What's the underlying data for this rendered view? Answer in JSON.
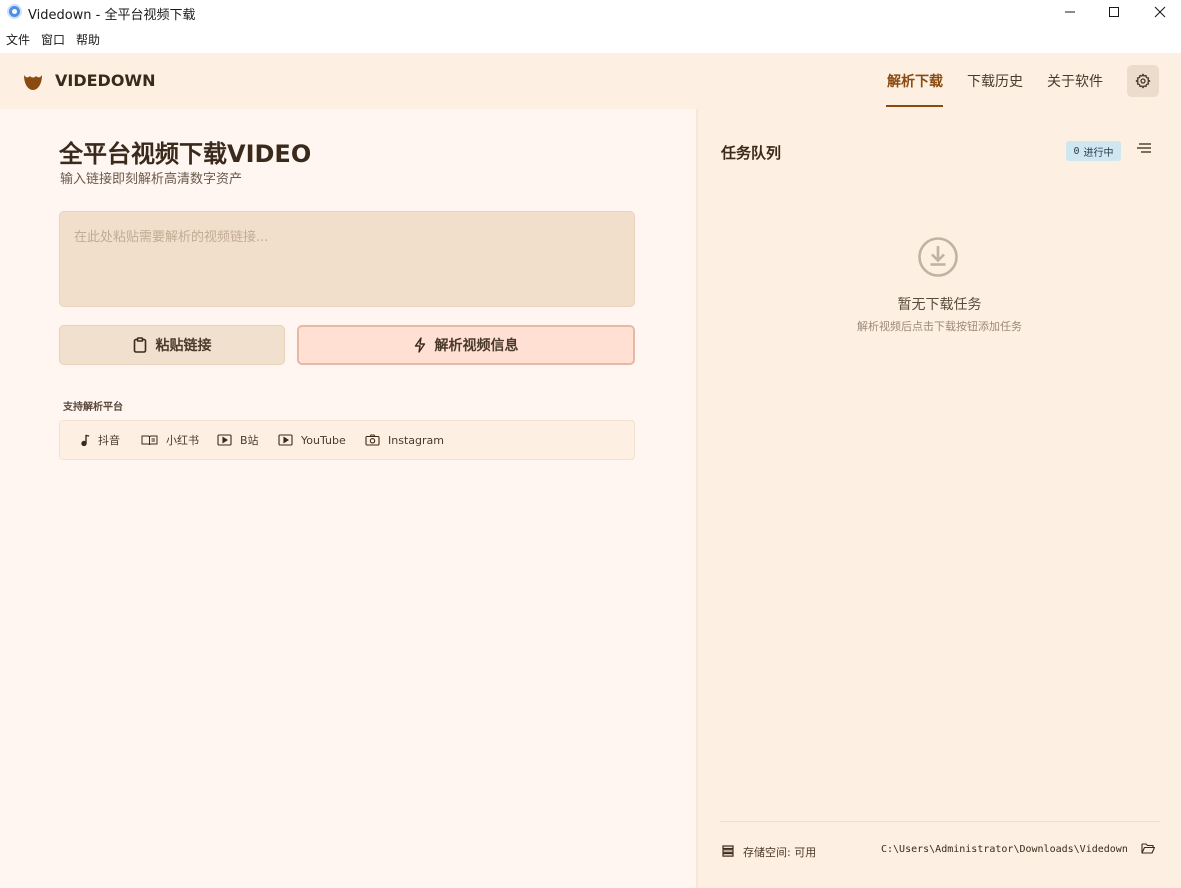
{
  "window": {
    "title": "Videdown - 全平台视频下载",
    "controls": [
      "minimize-icon",
      "maximize-icon",
      "close-icon"
    ]
  },
  "menu": [
    "文件",
    "窗口",
    "帮助"
  ],
  "header": {
    "brand": "VIDEDOWN",
    "tabs": [
      {
        "label": "解析下载",
        "active": true
      },
      {
        "label": "下载历史",
        "active": false
      },
      {
        "label": "关于软件",
        "active": false
      }
    ],
    "settings_icon": "gear-icon",
    "accent_color": "#8a4b10"
  },
  "main": {
    "title": "全平台视频下载VIDEO",
    "subtitle": "输入链接即刻解析高清数字资产",
    "url_input": {
      "value": "",
      "placeholder": "在此处粘贴需要解析的视频链接..."
    },
    "paste_button": "粘贴链接",
    "parse_button": "解析视频信息",
    "platforms_heading": "支持解析平台",
    "platforms": [
      {
        "label": "抖音",
        "icon": "music-note-icon"
      },
      {
        "label": "小红书",
        "icon": "book-icon"
      },
      {
        "label": "B站",
        "icon": "play-box-icon"
      },
      {
        "label": "YouTube",
        "icon": "play-box-icon"
      },
      {
        "label": "Instagram",
        "icon": "camera-icon"
      }
    ]
  },
  "queue": {
    "title": "任务队列",
    "badge_count": "0",
    "badge_label": "进行中",
    "empty_title": "暂无下载任务",
    "empty_subtitle": "解析视频后点击下载按钮添加任务",
    "storage_label": "存储空间: 可用",
    "download_path": "C:\\Users\\Administrator\\Downloads\\Videdown"
  }
}
